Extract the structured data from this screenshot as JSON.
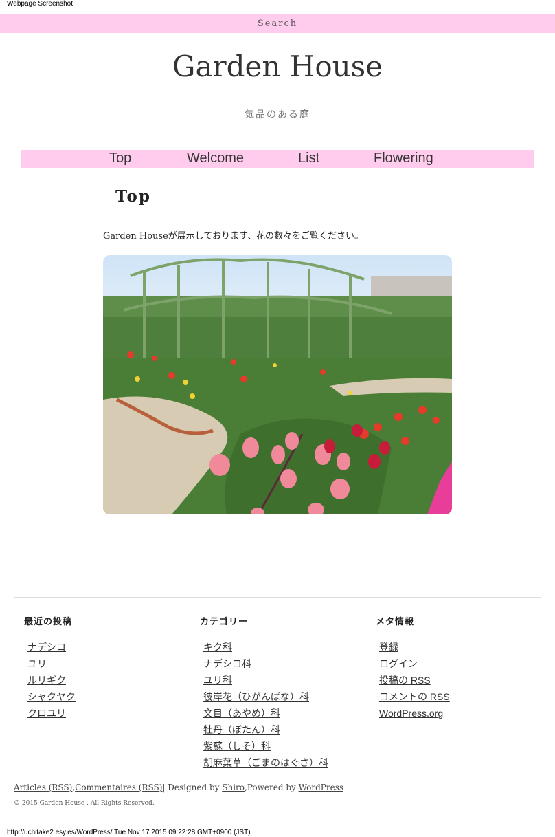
{
  "screenshot_caption": "Webpage Screenshot",
  "search": {
    "label": "Search"
  },
  "site": {
    "title": "Garden House",
    "tagline": "気品のある庭"
  },
  "nav": {
    "items": [
      {
        "label": "Top"
      },
      {
        "label": "Welcome"
      },
      {
        "label": "List"
      },
      {
        "label": "Flowering"
      }
    ]
  },
  "main": {
    "heading": "Top",
    "intro": "Garden Houseが展示しております、花の数々をご覧ください。"
  },
  "colors": {
    "accent_pink": "#ffccee",
    "text": "#333333"
  },
  "footer": {
    "recent_posts": {
      "title": "最近の投稿",
      "items": [
        "ナデシコ",
        "ユリ",
        "ルリギク",
        "シャクヤク",
        "クロユリ"
      ]
    },
    "categories": {
      "title": "カテゴリー",
      "items": [
        "キク科",
        "ナデシコ科",
        "ユリ科",
        "彼岸花（ひがんばな）科",
        "文目（あやめ）科",
        "牡丹（ぼたん）科",
        "紫蘇（しそ）科",
        "胡麻葉草（ごまのはぐさ）科"
      ]
    },
    "meta": {
      "title": "メタ情報",
      "items": [
        "登録",
        "ログイン",
        "投稿の RSS",
        "コメントの RSS",
        "WordPress.org"
      ]
    },
    "articles_rss": "Articles (RSS)",
    "comma": ",",
    "comments_rss": "Commentaires (RSS)",
    "designed_by_text": "| Designed by ",
    "designer": "Shiro",
    "powered_by_text": ",Powered by ",
    "platform": "WordPress",
    "copyright": "© 2015 Garden House . All Rights Reserved."
  },
  "capture_info": "http://uchitake2.esy.es/WordPress/ Tue Nov 17 2015 09:22:28 GMT+0900 (JST)"
}
